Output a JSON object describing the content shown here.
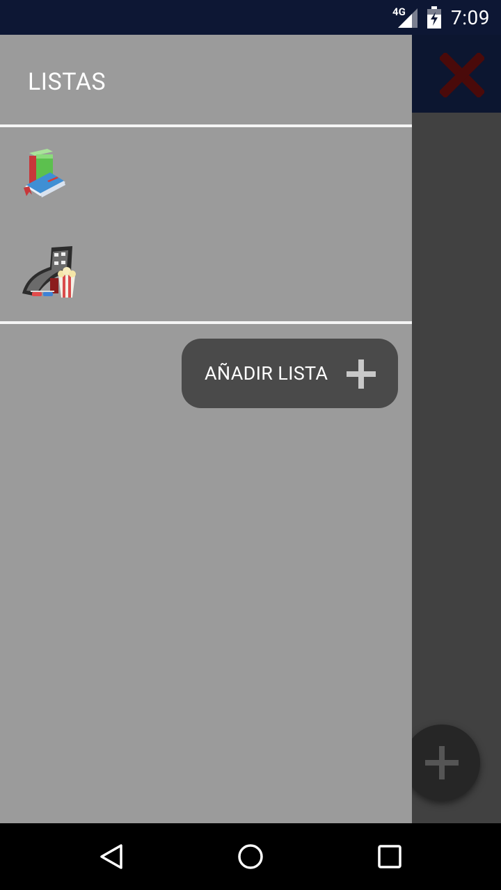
{
  "status_bar": {
    "network": "4G",
    "time": "7:09"
  },
  "drawer": {
    "title": "LISTAS",
    "items": [
      {
        "icon": "books-icon"
      },
      {
        "icon": "movies-popcorn-icon"
      }
    ],
    "add_button": {
      "label": "AÑADIR LISTA",
      "icon": "plus-icon"
    }
  },
  "app": {
    "close_icon": "close-x-icon",
    "fab_icon": "plus-icon"
  },
  "nav_bar": [
    "back-icon",
    "home-icon",
    "recents-icon"
  ]
}
